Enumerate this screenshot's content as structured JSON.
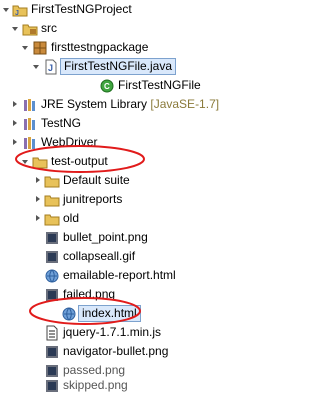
{
  "tree": {
    "rows": [
      {
        "label": "FirstTestNGProject",
        "icon": "java-project-icon"
      },
      {
        "label": "src",
        "icon": "source-folder-icon"
      },
      {
        "label": "firsttestngpackage",
        "icon": "package-icon"
      },
      {
        "label": "FirstTestNGFile.java",
        "icon": "java-file-icon"
      },
      {
        "label": "FirstTestNGFile",
        "icon": "java-class-icon"
      },
      {
        "label": "JRE System Library",
        "decoration": "[JavaSE-1.7]",
        "icon": "library-icon"
      },
      {
        "label": "TestNG",
        "icon": "library-icon"
      },
      {
        "label": "WebDriver",
        "icon": "library-icon"
      },
      {
        "label": "test-output",
        "icon": "folder-icon"
      },
      {
        "label": "Default suite",
        "icon": "folder-icon"
      },
      {
        "label": "junitreports",
        "icon": "folder-icon"
      },
      {
        "label": "old",
        "icon": "folder-icon"
      },
      {
        "label": "bullet_point.png",
        "icon": "image-file-icon"
      },
      {
        "label": "collapseall.gif",
        "icon": "image-file-icon"
      },
      {
        "label": "emailable-report.html",
        "icon": "html-file-icon"
      },
      {
        "label": "failed.png",
        "icon": "image-file-icon"
      },
      {
        "label": "index.html",
        "icon": "html-file-icon"
      },
      {
        "label": "jquery-1.7.1.min.js",
        "icon": "js-file-icon"
      },
      {
        "label": "navigator-bullet.png",
        "icon": "image-file-icon"
      },
      {
        "label": "passed.png",
        "icon": "image-file-icon"
      },
      {
        "label": "skipped.png",
        "icon": "image-file-icon"
      }
    ]
  },
  "colors": {
    "highlight_ellipse": "#e11b1b",
    "selection_bg": "#d9e8fb"
  }
}
